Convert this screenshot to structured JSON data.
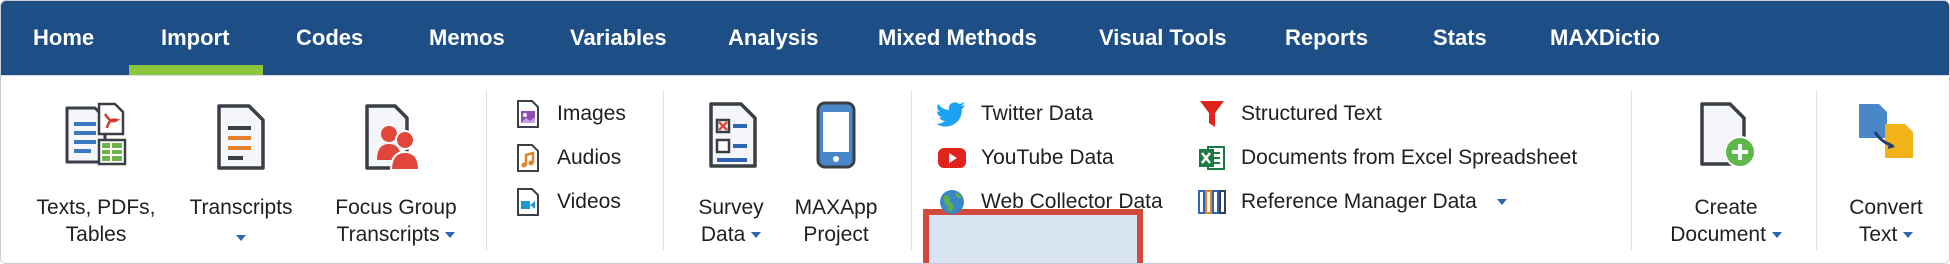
{
  "tabs": [
    {
      "label": "Home"
    },
    {
      "label": "Import"
    },
    {
      "label": "Codes"
    },
    {
      "label": "Memos"
    },
    {
      "label": "Variables"
    },
    {
      "label": "Analysis"
    },
    {
      "label": "Mixed Methods"
    },
    {
      "label": "Visual Tools"
    },
    {
      "label": "Reports"
    },
    {
      "label": "Stats"
    },
    {
      "label": "MAXDictio"
    }
  ],
  "active_tab": "Import",
  "ribbon": {
    "texts_pdfs_tables": {
      "line1": "Texts, PDFs,",
      "line2": "Tables",
      "icon": "documents-icon"
    },
    "transcripts": {
      "line1": "Transcripts",
      "icon": "transcript-icon"
    },
    "focus_group": {
      "line1": "Focus Group",
      "line2": "Transcripts",
      "icon": "focus-group-icon"
    },
    "images": {
      "label": "Images",
      "icon": "image-icon"
    },
    "audios": {
      "label": "Audios",
      "icon": "audio-icon"
    },
    "videos": {
      "label": "Videos",
      "icon": "video-icon"
    },
    "survey_data": {
      "line1": "Survey",
      "line2": "Data",
      "icon": "survey-icon"
    },
    "maxapp": {
      "line1": "MAXApp",
      "line2": "Project",
      "icon": "phone-icon"
    },
    "twitter": {
      "label": "Twitter Data",
      "icon": "twitter-icon"
    },
    "youtube": {
      "label": "YouTube Data",
      "icon": "youtube-icon"
    },
    "web_collector": {
      "label": "Web Collector Data",
      "icon": "globe-icon"
    },
    "structured_text": {
      "label": "Structured Text",
      "icon": "funnel-icon"
    },
    "excel": {
      "label": "Documents from Excel Spreadsheet",
      "icon": "excel-icon"
    },
    "reference_manager": {
      "label": "Reference Manager Data",
      "icon": "books-icon"
    },
    "create_document": {
      "line1": "Create",
      "line2": "Document",
      "icon": "new-document-icon"
    },
    "convert_text": {
      "line1": "Convert",
      "line2": "Text",
      "icon": "convert-icon"
    }
  },
  "colors": {
    "tabbar": "#1d4e85",
    "underline": "#8cc63f",
    "highlight_border": "#d24a3a",
    "highlight_fill": "#d8e4f1"
  }
}
